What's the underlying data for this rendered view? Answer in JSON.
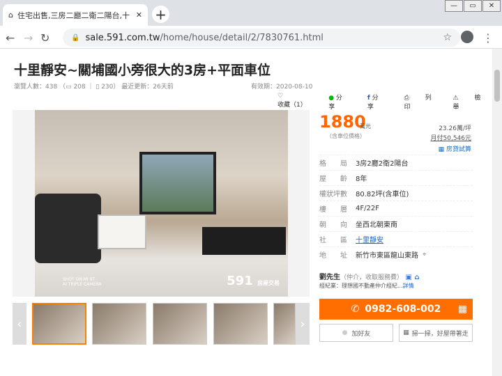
{
  "browser": {
    "tab_title": "住宅出售,三房二廳二衛二陽台,十",
    "tab_close": "✕",
    "new_tab": "+",
    "url_host": "sale.591.com.tw",
    "url_path": "/home/house/detail/2/7830761.html"
  },
  "listing": {
    "title": "十里靜安~關埔國小旁很大的3房+平面車位",
    "views_label": "瀏覽人數：438",
    "photos_count": "208",
    "phone_count": "230",
    "updated": "最近更新：26天前",
    "expiry": "有效期：2020-08-10",
    "actions": [
      "收藏（1）",
      "分享",
      "分享",
      "列印",
      "檢舉"
    ],
    "watermark": "591",
    "watermark_sub": "房屋交易",
    "camera_text": "SHOT ON MI 9T\nAI TRIPLE CAMERA"
  },
  "price": {
    "value": "1880",
    "unit": "萬元",
    "note": "（含車位價格）",
    "per_ping": "23.26萬/坪",
    "monthly": "月付50,546元",
    "loan_calc": "房貸試算"
  },
  "specs": [
    {
      "k": "格　　局",
      "v": "3房2廳2衛2陽台"
    },
    {
      "k": "屋　　齡",
      "v": "8年"
    },
    {
      "k": "權狀坪數",
      "v": "80.82坪(含車位)"
    },
    {
      "k": "樓　　層",
      "v": "4F/22F"
    },
    {
      "k": "朝　　向",
      "v": "坐西北朝東南"
    },
    {
      "k": "社　　區",
      "v": "十里靜安"
    },
    {
      "k": "地　　址",
      "v": "新竹市東區龍山東路"
    }
  ],
  "agent": {
    "name": "劉先生",
    "note": "（仲介，收取服務費）",
    "company": "經紀業：理想國不動產仲介經紀...",
    "company_more": "詳情",
    "phone": "0982-608-002",
    "add_friend": "加好友",
    "scan": "掃一掃，好屋帶著走"
  }
}
